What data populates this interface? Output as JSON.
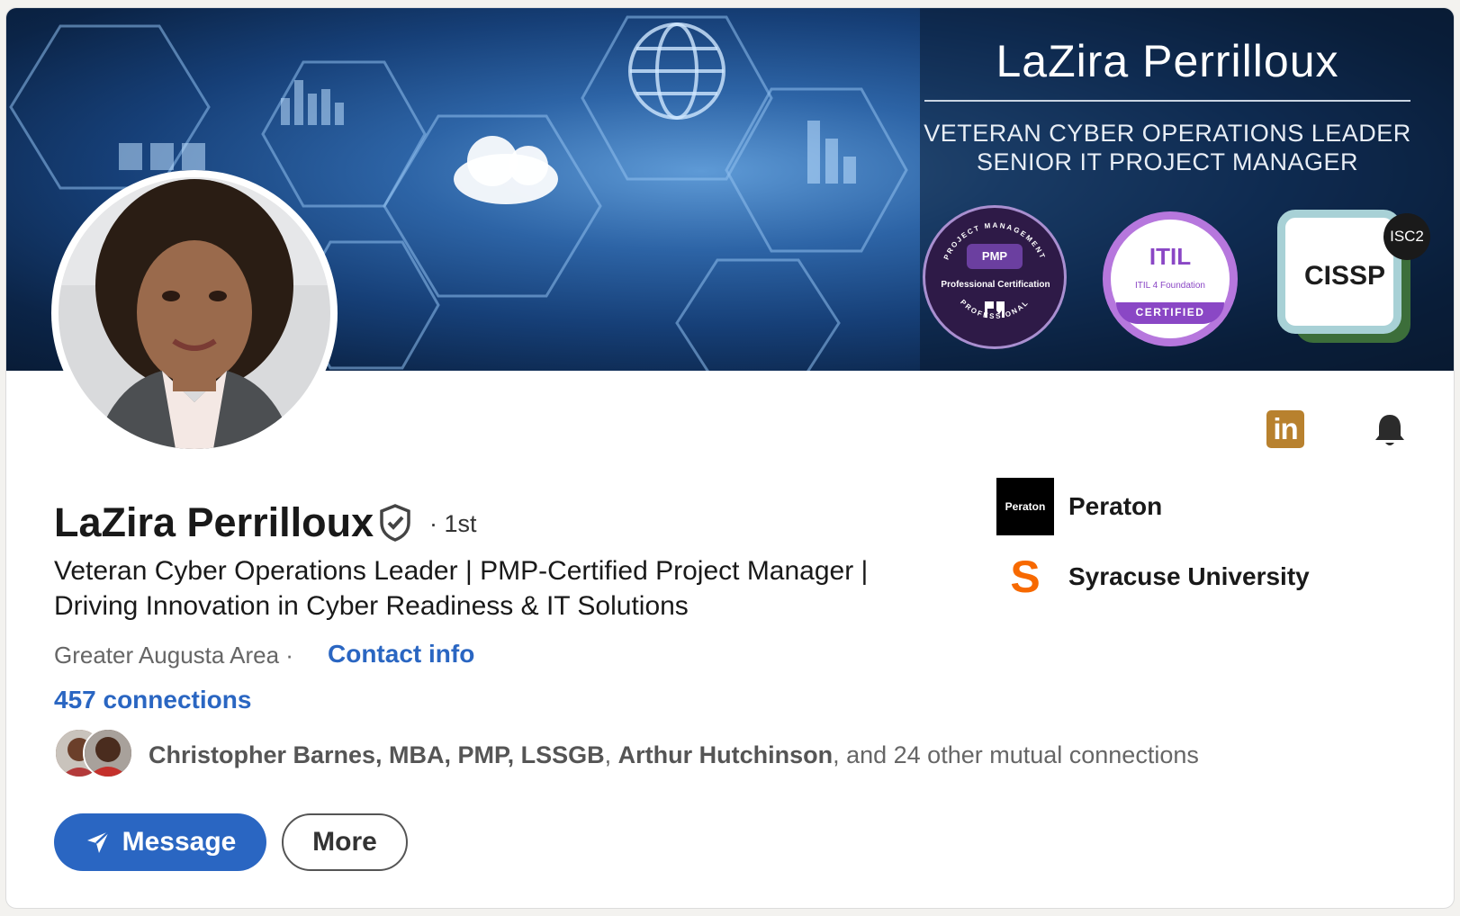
{
  "banner": {
    "title": "LaZira Perrilloux",
    "subtitle_line1": "VETERAN CYBER OPERATIONS LEADER",
    "subtitle_line2": "SENIOR IT PROJECT MANAGER",
    "badges": {
      "pmp": {
        "label": "PMP",
        "cert": "Professional Certification",
        "ring_top": "PROJECT MANAGEMENT",
        "ring_bottom": "PROFESSIONAL"
      },
      "itil": {
        "logo": "ITIL",
        "found": "ITIL 4 Foundation",
        "cert": "CERTIFIED"
      },
      "cissp": {
        "word": "CISSP",
        "org": "ISC2"
      }
    }
  },
  "profile": {
    "name": "LaZira Perrilloux",
    "degree": "· 1st",
    "headline": "Veteran Cyber Operations Leader | PMP-Certified Project Manager | Driving Innovation in Cyber Readiness & IT Solutions",
    "location": "Greater Augusta Area ·",
    "contact_info": "Contact info",
    "connections": "457 connections",
    "mutual": {
      "name1": "Christopher Barnes, MBA, PMP, LSSGB",
      "sep": ", ",
      "name2": "Arthur Hutchinson",
      "rest": ", and 24 other mutual connections"
    }
  },
  "actions": {
    "message": "Message",
    "more": "More"
  },
  "orgs": [
    {
      "name": "Peraton",
      "logo_text": "Peraton"
    },
    {
      "name": "Syracuse University",
      "logo_text": "S"
    }
  ],
  "icons": {
    "linkedin": "linkedin-icon",
    "bell": "bell-icon",
    "verified": "verified-shield-icon",
    "send": "send-icon"
  },
  "colors": {
    "accent": "#2a66c2",
    "linkedin_badge": "#b8812e",
    "su_orange": "#f76900"
  }
}
